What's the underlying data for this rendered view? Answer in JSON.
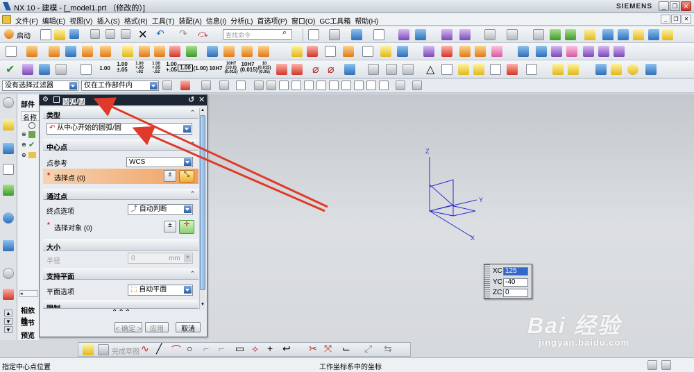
{
  "window": {
    "title": "NX 10 - 建模 - [_model1.prt （修改的）]",
    "brand": "SIEMENS",
    "controls": {
      "minimize": "_",
      "restore": "❐",
      "close": "✕"
    },
    "mdi_controls": {
      "minimize": "_",
      "restore": "❐",
      "close": "✕"
    }
  },
  "menubar": {
    "items": [
      "文件(F)",
      "编辑(E)",
      "视图(V)",
      "插入(S)",
      "格式(R)",
      "工具(T)",
      "装配(A)",
      "信息(I)",
      "分析(L)",
      "首选项(P)",
      "窗口(O)",
      "GC工具箱",
      "帮助(H)"
    ]
  },
  "toolbar1": {
    "start_label": "启动",
    "search_placeholder": "查找命令"
  },
  "toolbar3": {
    "tolerance_labels": [
      "1.00",
      "1.00\n±.05",
      "1.00\n+.05\n-.02",
      "1.00\n+.05\n-.02",
      "1.00\n+.05",
      "1.00",
      "(1.00)",
      "10H7",
      "10H7\n(10.0)\n(0.015)",
      "10H7\n(0.015)",
      "10\n(0.015)\n(0.05)"
    ]
  },
  "filterbar": {
    "type_filter": "没有选择过滤器",
    "scope_filter": "仅在工作部件内"
  },
  "left_nav": {
    "header": "部件导",
    "column_name": "名称",
    "bottom_tabs": [
      "相依性",
      "细节",
      "预览"
    ]
  },
  "dialog": {
    "title": "圆弧/圆",
    "sections": {
      "type": {
        "header": "类型",
        "value": "从中心开始的圆弧/圆"
      },
      "center": {
        "header": "中心点",
        "point_ref_label": "点参考",
        "point_ref_value": "WCS",
        "select_point": "选择点 (0)"
      },
      "through": {
        "header": "通过点",
        "end_option_label": "终点选项",
        "end_option_value": "自动判断",
        "select_object": "选择对象 (0)"
      },
      "size": {
        "header": "大小",
        "radius_label": "半径",
        "radius_value": "0",
        "radius_unit": "mm"
      },
      "support": {
        "header": "支持平面",
        "plane_label": "平面选项",
        "plane_value": "自动平面"
      },
      "limit": {
        "header": "限制"
      }
    },
    "more": "⌃⌃⌃",
    "buttons": {
      "ok": "< 确定 >",
      "apply": "应用",
      "cancel": "取消"
    }
  },
  "graphics": {
    "axis_labels": {
      "z": "Z",
      "y": "Y",
      "x": "X"
    },
    "coord_popup": {
      "xc_label": "XC",
      "xc_value": "125",
      "yc_label": "YC",
      "yc_value": "-40",
      "zc_label": "ZC",
      "zc_value": "0"
    },
    "watermark": {
      "main": "Bai  经验",
      "sub": "jingyan.baidu.com"
    }
  },
  "snapbar": {
    "finish_sketch": "完成草图"
  },
  "statusbar": {
    "left": "指定中心点位置",
    "center": "工作坐标系中的坐标"
  },
  "colors": {
    "axis_blue": "#2a2ad6",
    "annotation_red": "#e03a2a",
    "dialog_title_bg": "#1d2734",
    "select_highlight": "#f0a060"
  }
}
